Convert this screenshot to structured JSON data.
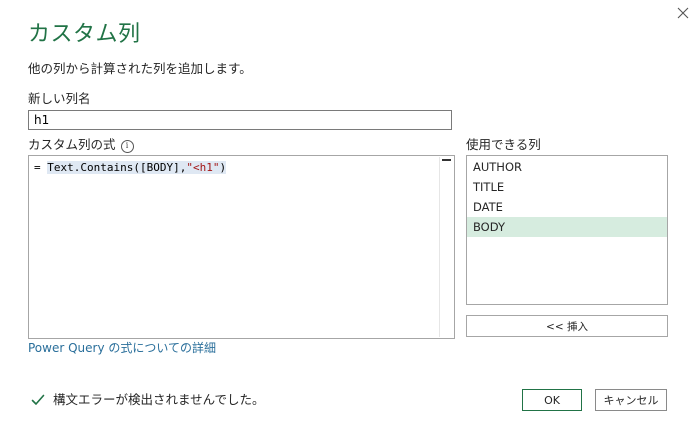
{
  "dialog": {
    "title": "カスタム列",
    "subtitle": "他の列から計算された列を追加します。",
    "close_icon": "close-icon"
  },
  "new_column": {
    "label": "新しい列名",
    "value": "h1"
  },
  "formula": {
    "label": "カスタム列の式",
    "info_icon": "info-icon",
    "prefix": "= ",
    "code_highlighted": "Text.Contains([BODY],",
    "code_string": "\"<h1\"",
    "code_tail": ")"
  },
  "available_columns": {
    "label": "使用できる列",
    "items": [
      "AUTHOR",
      "TITLE",
      "DATE",
      "BODY"
    ],
    "selected": "BODY",
    "insert_button": "<< 挿入"
  },
  "help_link": "Power Query の式についての詳細",
  "status": {
    "icon": "check-icon",
    "text": "構文エラーが検出されませんでした。",
    "color": "#217346"
  },
  "buttons": {
    "ok": "OK",
    "cancel": "キャンセル"
  },
  "colors": {
    "accent": "#217346",
    "selected_bg": "#d6ecdf",
    "link": "#2a6f9b",
    "string": "#a31515"
  }
}
